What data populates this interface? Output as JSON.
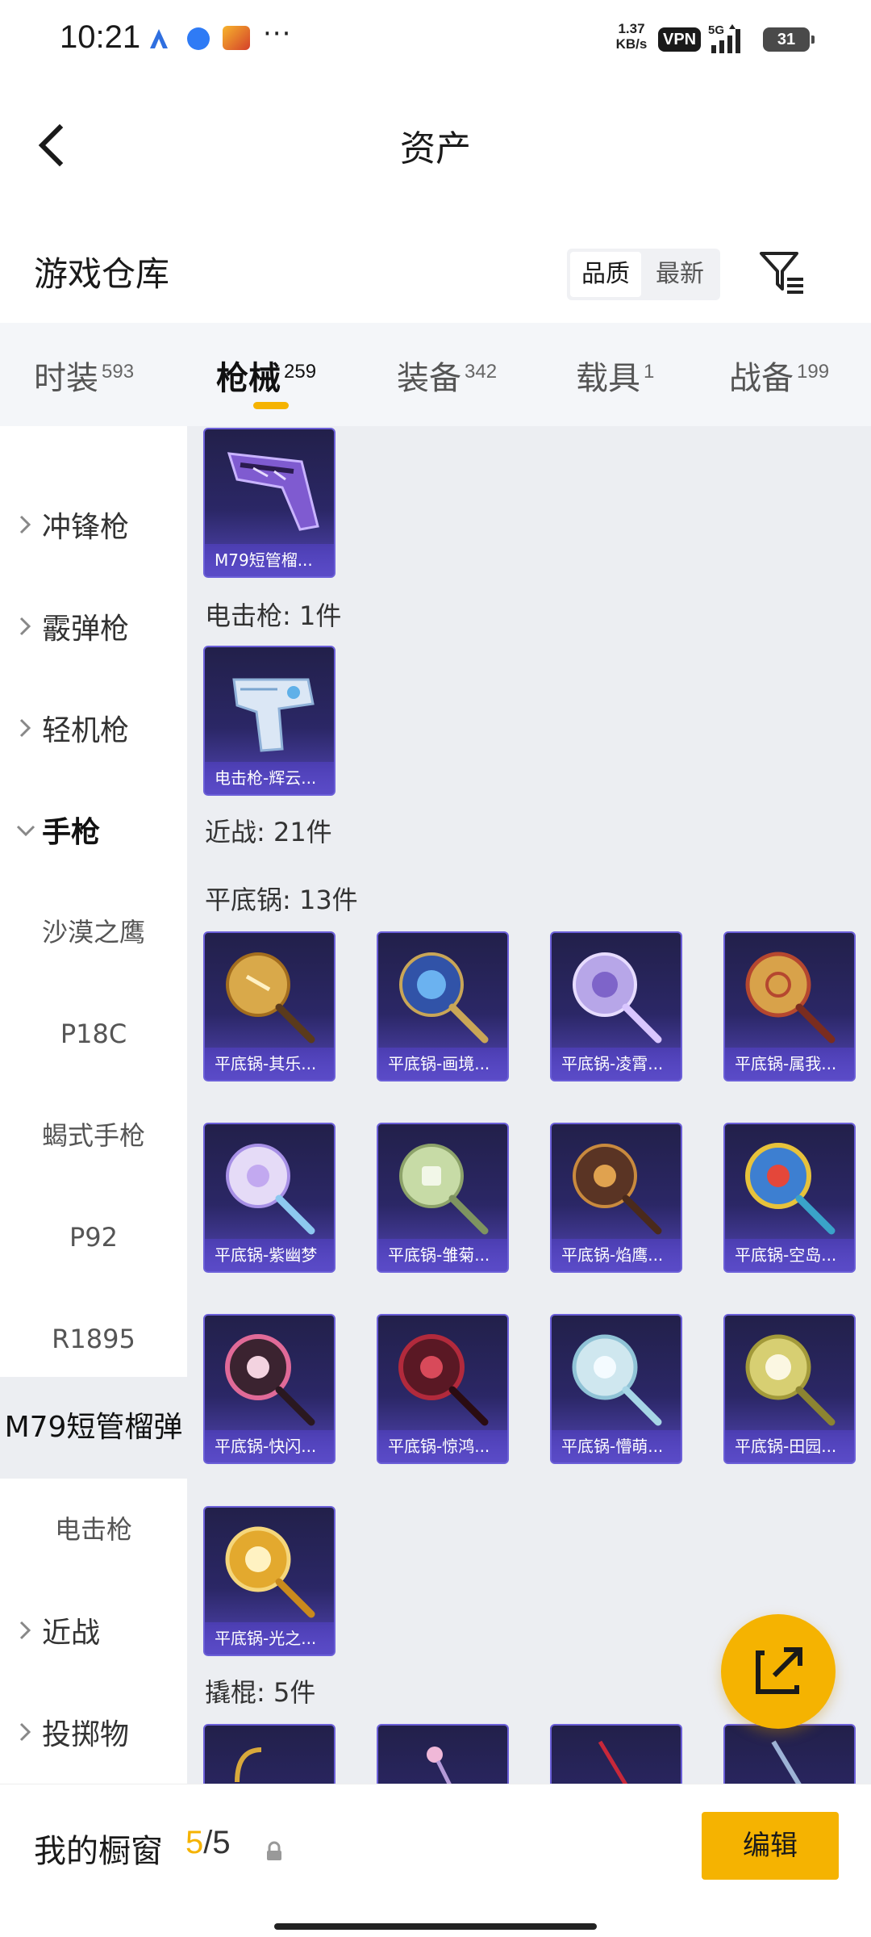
{
  "status_bar": {
    "time": "10:21",
    "net_speed": "1.37",
    "net_speed_unit": "KB/s",
    "vpn": "VPN",
    "network": "5G",
    "battery": "31"
  },
  "header": {
    "back_icon": "chevron-left-icon",
    "title": "资产"
  },
  "warehouse": {
    "title": "游戏仓库",
    "sort_options": [
      "品质",
      "最新"
    ],
    "active_sort": "品质",
    "filter_icon": "filter-icon"
  },
  "tabs": [
    {
      "label": "时装",
      "count": "593"
    },
    {
      "label": "枪械",
      "count": "259",
      "active": true
    },
    {
      "label": "装备",
      "count": "342"
    },
    {
      "label": "载具",
      "count": "1"
    },
    {
      "label": "战备",
      "count": "199"
    }
  ],
  "sidebar": {
    "groups": [
      {
        "label": "冲锋枪"
      },
      {
        "label": "霰弹枪"
      },
      {
        "label": "轻机枪"
      },
      {
        "label": "手枪",
        "expanded": true
      },
      {
        "label": "近战"
      },
      {
        "label": "投掷物"
      }
    ],
    "sub_items": [
      "沙漠之鹰",
      "P18C",
      "蝎式手枪",
      "P92",
      "R1895",
      "M79短管榴弹",
      "电击枪"
    ],
    "selected_sub": "M79短管榴弹"
  },
  "content": {
    "sections": [
      {
        "title": "",
        "items": [
          "M79短管榴..."
        ]
      },
      {
        "title": "电击枪: 1件",
        "items": [
          "电击枪-辉云..."
        ]
      },
      {
        "title": "近战: 21件",
        "items": []
      },
      {
        "title": "平底锅: 13件",
        "items": [
          "平底锅-其乐...",
          "平底锅-画境...",
          "平底锅-凌霄...",
          "平底锅-属我...",
          "平底锅-紫幽梦",
          "平底锅-雏菊...",
          "平底锅-焰鹰...",
          "平底锅-空岛...",
          "平底锅-快闪...",
          "平底锅-惊鸿...",
          "平底锅-懵萌...",
          "平底锅-田园...",
          "平底锅-光之..."
        ]
      },
      {
        "title": "撬棍: 5件",
        "items": []
      }
    ]
  },
  "fab_icon": "share-icon",
  "showcase": {
    "title": "我的橱窗",
    "current": "5",
    "separator": "/",
    "max": "5",
    "lock_icon": "lock-icon",
    "edit_label": "编辑"
  },
  "colors": {
    "accent": "#f5b301",
    "card_top": "#22204a",
    "card_bottom": "#5447b9",
    "content_bg": "#eceef2"
  }
}
